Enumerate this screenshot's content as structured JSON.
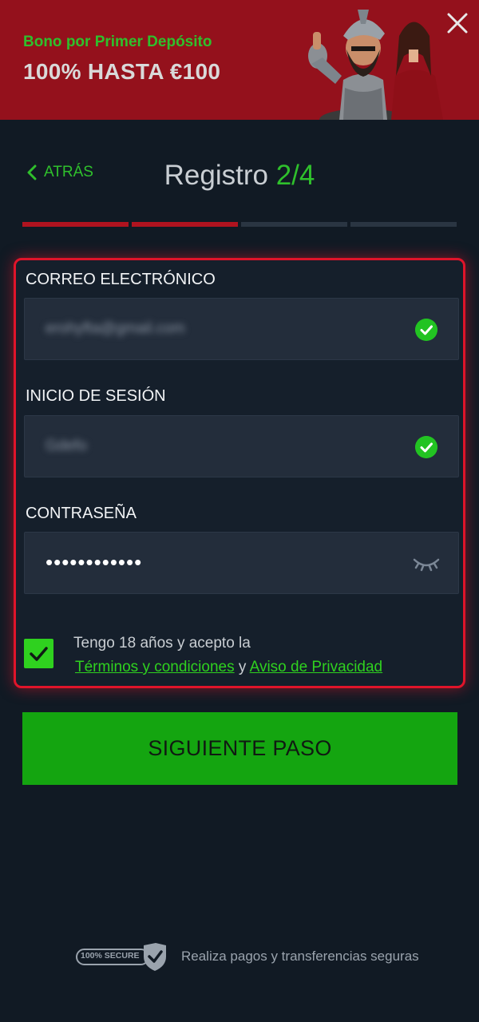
{
  "banner": {
    "subtitle": "Bono por Primer Depósito",
    "title": "100% HASTA €100"
  },
  "header": {
    "back_label": "ATRÁS",
    "title": "Registro",
    "step": "2/4"
  },
  "progress": {
    "current_step": 2,
    "total_steps": 4
  },
  "form": {
    "email_label": "CORREO ELECTRÓNICO",
    "email_value": "erohyfta@gmail.com",
    "login_label": "INICIO DE SESIÓN",
    "login_value": "Gdefo",
    "password_label": "CONTRASEÑA",
    "password_value": "••••••••••••",
    "terms_text": "Tengo 18 años y acepto la",
    "terms_link": "Términos y condiciones",
    "conjunction": "y",
    "privacy_link": "Aviso de Privacidad",
    "accepted": true
  },
  "next_button": "SIGUIENTE PASO",
  "footer": {
    "badge_text": "100% SECURE",
    "secure_text": "Realiza pagos y transferencias seguras"
  },
  "colors": {
    "banner_bg": "#94111c",
    "accent_green": "#2fc02c",
    "accent_red": "#e0142a",
    "button_green": "#14a510",
    "background": "#111a24"
  }
}
